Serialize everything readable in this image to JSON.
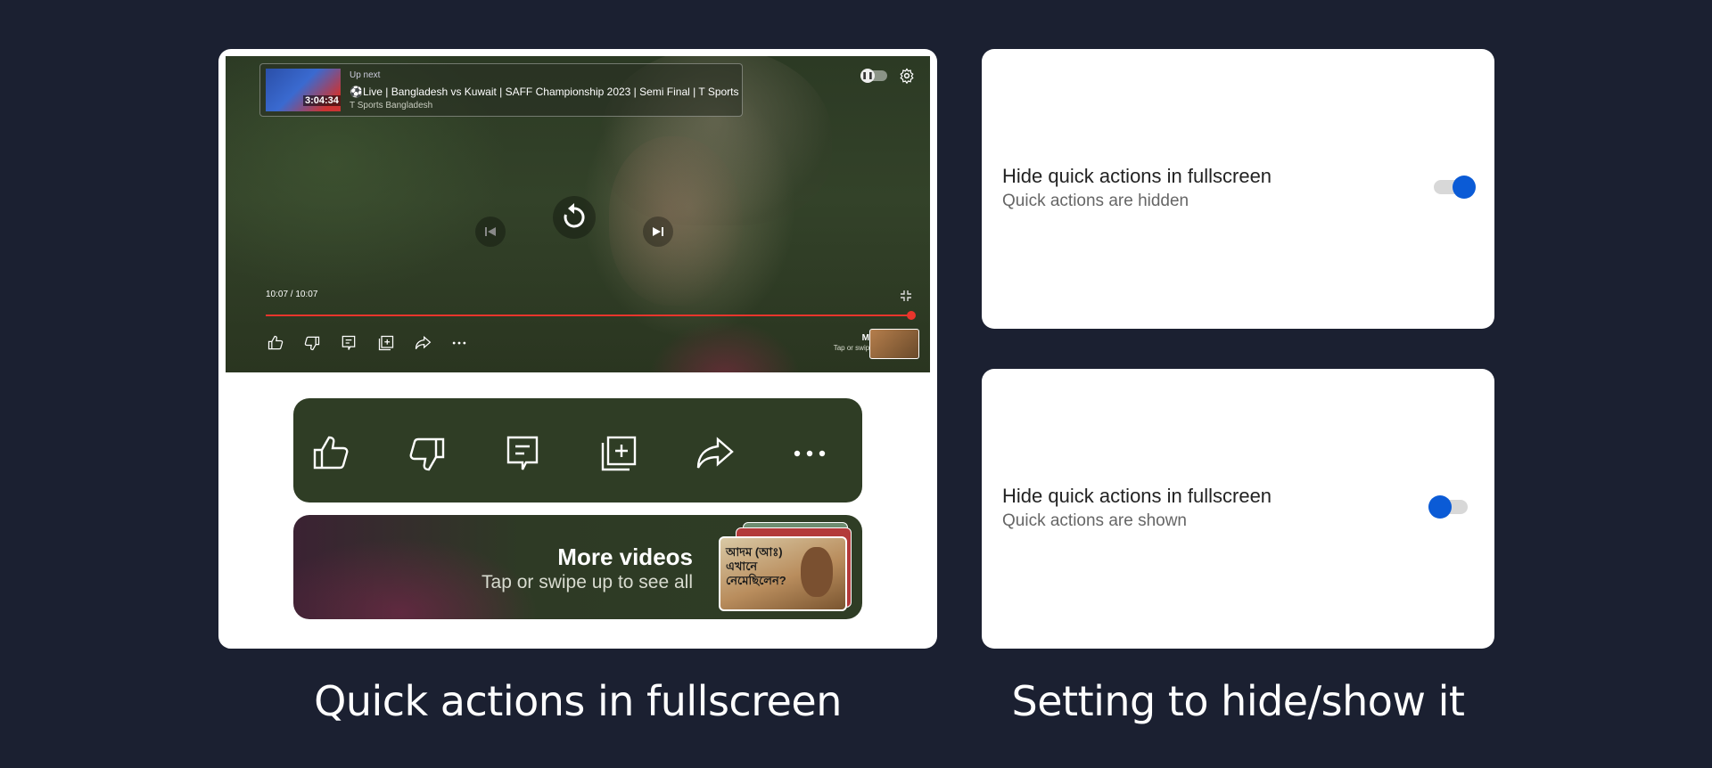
{
  "player": {
    "up_next": {
      "label": "Up next",
      "title": "⚽Live | Bangladesh vs Kuwait | SAFF Championship 2023 | Semi Final | T Sports",
      "channel": "T Sports Bangladesh",
      "duration": "3:04:34"
    },
    "time": "10:07 / 10:07",
    "progress": 1.0,
    "more_videos": {
      "title": "More videos",
      "subtitle": "Tap or swipe up to see all"
    }
  },
  "quick_actions": {
    "items": [
      "like-icon",
      "dislike-icon",
      "comments-icon",
      "save-to-playlist-icon",
      "share-icon",
      "more-options-icon"
    ]
  },
  "more_videos_bar": {
    "title": "More videos",
    "subtitle": "Tap or swipe up to see all",
    "thumb_text": "আদম (আঃ) এখানে নেমেছিলেন?"
  },
  "settings": [
    {
      "title": "Hide quick actions in fullscreen",
      "subtitle": "Quick actions are hidden",
      "enabled": true
    },
    {
      "title": "Hide quick actions in fullscreen",
      "subtitle": "Quick actions are shown",
      "enabled": false
    }
  ],
  "captions": {
    "left": "Quick actions in fullscreen",
    "right": "Setting  to hide/show it"
  },
  "colors": {
    "background": "#1b2031",
    "progress": "#e8352c",
    "toggle_accent": "#0b5bd6"
  }
}
